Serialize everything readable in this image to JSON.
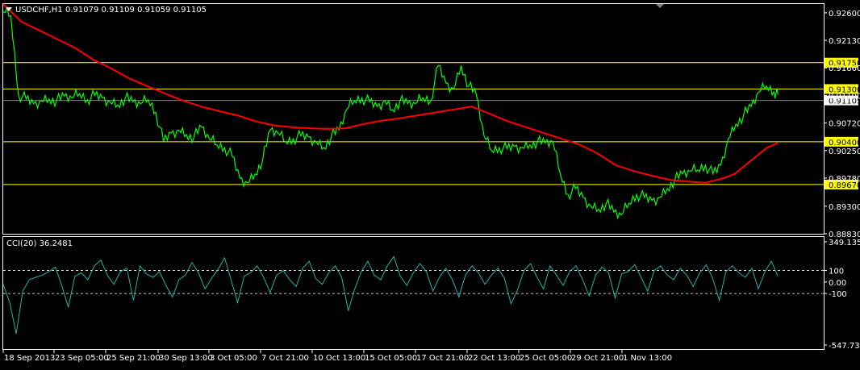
{
  "header": {
    "symbol": "USDCHF,H1",
    "ohlc": "0.91079 0.91109 0.91059 0.91105",
    "collapse_icon": "triangle-down-icon"
  },
  "colors": {
    "background": "#000000",
    "price_line": "#00ff00",
    "ma_line": "#ff0000",
    "level_lines": "#ffff00",
    "cci_line": "#20b2aa",
    "grid_text": "#ffffff",
    "current_price_line": "#808080"
  },
  "chart_data": [
    {
      "type": "line",
      "title": "USDCHF,H1",
      "ylim": [
        0.8883,
        0.9275
      ],
      "y_ticks": [
        "0.92600",
        "0.92130",
        "0.91660",
        "0.91190",
        "0.90720",
        "0.90250",
        "0.89780",
        "0.89300",
        "0.88830"
      ],
      "x_ticks": [
        "18 Sep 2013",
        "23 Sep 05:00",
        "25 Sep 21:00",
        "30 Sep 13:00",
        "3 Oct 05:00",
        "7 Oct 21:00",
        "10 Oct 13:00",
        "15 Oct 05:00",
        "17 Oct 21:00",
        "22 Oct 13:00",
        "25 Oct 05:00",
        "29 Oct 21:00",
        "1 Nov 13:00"
      ],
      "x_index": [
        0,
        8,
        16,
        24,
        32,
        40,
        48,
        56,
        64,
        72,
        80,
        88,
        96,
        104,
        112,
        120,
        128,
        136,
        144,
        152,
        160,
        168,
        176,
        184,
        192,
        200,
        208,
        216,
        224,
        232,
        240,
        248,
        256,
        264,
        272,
        280,
        288,
        296,
        304,
        312,
        320,
        328,
        336,
        344,
        352,
        360,
        368,
        376,
        384,
        392,
        400,
        408,
        416,
        424,
        432,
        440,
        448,
        456,
        464,
        472,
        480,
        488,
        496,
        504,
        512,
        520,
        528,
        536,
        544,
        552,
        560,
        568,
        576,
        584,
        592,
        600,
        608,
        616,
        624,
        632,
        640,
        648,
        656,
        664,
        672,
        680,
        688,
        696,
        704,
        712,
        720,
        728,
        736,
        744,
        752,
        760,
        768,
        776,
        784,
        792,
        800,
        808,
        812
      ],
      "series": [
        {
          "name": "USDCHF",
          "values": [
            0.9262,
            0.9255,
            0.912,
            0.9113,
            0.9105,
            0.911,
            0.9113,
            0.911,
            0.9118,
            0.9115,
            0.9122,
            0.9112,
            0.9119,
            0.9115,
            0.9108,
            0.9103,
            0.9115,
            0.9108,
            0.9105,
            0.9112,
            0.909,
            0.904,
            0.9055,
            0.906,
            0.9052,
            0.9048,
            0.9065,
            0.9045,
            0.9035,
            0.903,
            0.9015,
            0.8978,
            0.897,
            0.8985,
            0.901,
            0.906,
            0.9055,
            0.904,
            0.9045,
            0.905,
            0.9048,
            0.904,
            0.903,
            0.905,
            0.906,
            0.9095,
            0.911,
            0.9115,
            0.9108,
            0.91,
            0.911,
            0.9095,
            0.911,
            0.9105,
            0.9105,
            0.9115,
            0.911,
            0.917,
            0.914,
            0.913,
            0.917,
            0.9135,
            0.912,
            0.905,
            0.9025,
            0.903,
            0.9028,
            0.9032,
            0.903,
            0.9035,
            0.904,
            0.9038,
            0.904,
            0.8985,
            0.895,
            0.896,
            0.8945,
            0.893,
            0.8925,
            0.8935,
            0.892,
            0.8915,
            0.8935,
            0.895,
            0.8945,
            0.894,
            0.8945,
            0.896,
            0.8975,
            0.8985,
            0.899,
            0.8992,
            0.9,
            0.8985,
            0.9,
            0.9045,
            0.907,
            0.9085,
            0.91,
            0.9125,
            0.9135,
            0.9125,
            0.912,
            0.911
          ]
        },
        {
          "name": "MA",
          "values": [
            0.9275,
            0.9245,
            0.923,
            0.9215,
            0.92,
            0.918,
            0.9165,
            0.9148,
            0.9135,
            0.9122,
            0.911,
            0.91,
            0.9092,
            0.9085,
            0.9075,
            0.9068,
            0.9065,
            0.9063,
            0.9062,
            0.9063,
            0.907,
            0.9076,
            0.908,
            0.9085,
            0.909,
            0.9095,
            0.91,
            0.9088,
            0.9075,
            0.9065,
            0.9055,
            0.9045,
            0.9035,
            0.902,
            0.9,
            0.899,
            0.8982,
            0.8975,
            0.8972,
            0.897,
            0.8978,
            0.8985,
            0.9,
            0.9015,
            0.903,
            0.9038
          ],
          "x": [
            0,
            20,
            40,
            60,
            80,
            100,
            120,
            140,
            160,
            180,
            200,
            220,
            240,
            260,
            280,
            300,
            320,
            340,
            360,
            380,
            400,
            420,
            440,
            460,
            480,
            500,
            520,
            540,
            560,
            580,
            600,
            620,
            640,
            660,
            680,
            700,
            720,
            740,
            760,
            780,
            800,
            812,
            824,
            836,
            848,
            860
          ]
        }
      ],
      "levels": [
        {
          "value": 0.9175,
          "label": "0.91750"
        },
        {
          "value": 0.913,
          "label": "0.91300"
        },
        {
          "value": 0.904,
          "label": "0.90400"
        },
        {
          "value": 0.8967,
          "label": "0.89670"
        }
      ],
      "current_price": {
        "value": 0.91105,
        "label": "0.91105"
      }
    },
    {
      "type": "line",
      "title": "CCI(20) 36.2481",
      "ylim": [
        -547.7342,
        349.1358
      ],
      "y_ticks": [
        "349.1358",
        "100",
        "0.00",
        "-100",
        "-547.7342"
      ],
      "reference_lines": [
        100,
        -100
      ],
      "series": [
        {
          "name": "CCI(20)",
          "values": [
            -20,
            -180,
            -450,
            -80,
            20,
            40,
            60,
            90,
            130,
            -30,
            -220,
            50,
            80,
            20,
            140,
            190,
            60,
            -20,
            90,
            120,
            -160,
            140,
            70,
            40,
            90,
            -30,
            -130,
            20,
            60,
            170,
            80,
            -60,
            30,
            110,
            210,
            20,
            -180,
            50,
            80,
            140,
            40,
            -90,
            60,
            100,
            20,
            -40,
            120,
            180,
            30,
            -20,
            80,
            140,
            40,
            -250,
            -60,
            90,
            180,
            60,
            20,
            140,
            220,
            50,
            -30,
            80,
            160,
            90,
            -80,
            40,
            120,
            20,
            -130,
            60,
            140,
            80,
            -20,
            60,
            120,
            30,
            -190,
            -70,
            100,
            160,
            40,
            -60,
            140,
            60,
            -30,
            90,
            140,
            20,
            -120,
            60,
            130,
            80,
            -140,
            70,
            90,
            150,
            40,
            -80,
            100,
            140,
            60,
            20,
            120,
            60,
            -40,
            80,
            150,
            30,
            -160,
            90,
            140,
            80,
            40,
            120,
            -60,
            90,
            180,
            50
          ]
        }
      ]
    }
  ]
}
